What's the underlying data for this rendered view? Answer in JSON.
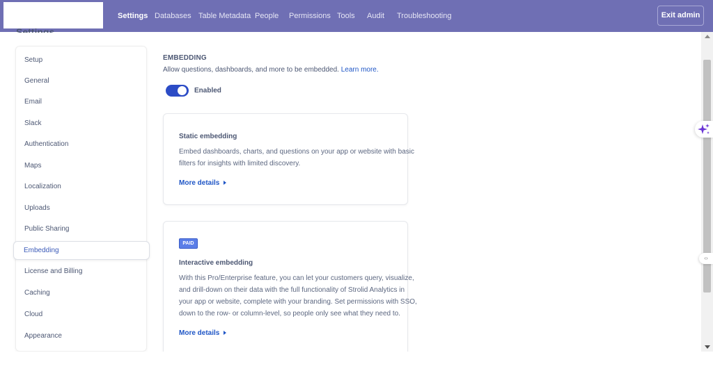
{
  "nav": {
    "items": [
      {
        "label": "Settings",
        "active": true
      },
      {
        "label": "Databases"
      },
      {
        "label": "Table Metadata"
      },
      {
        "label": "People"
      },
      {
        "label": "Permissions"
      },
      {
        "label": "Tools"
      },
      {
        "label": "Audit"
      },
      {
        "label": "Troubleshooting"
      }
    ],
    "exit_label": "Exit admin"
  },
  "settings_heading": "Settings",
  "sidebar": {
    "items": [
      {
        "label": "Setup"
      },
      {
        "label": "General"
      },
      {
        "label": "Email"
      },
      {
        "label": "Slack"
      },
      {
        "label": "Authentication"
      },
      {
        "label": "Maps"
      },
      {
        "label": "Localization"
      },
      {
        "label": "Uploads"
      },
      {
        "label": "Public Sharing"
      },
      {
        "label": "Embedding",
        "active": true
      },
      {
        "label": "License and Billing"
      },
      {
        "label": "Caching"
      },
      {
        "label": "Cloud"
      },
      {
        "label": "Appearance"
      }
    ]
  },
  "main": {
    "section_title": "EMBEDDING",
    "section_desc": "Allow questions, dashboards, and more to be embedded.",
    "learn_more": "Learn more.",
    "toggle": {
      "label": "Enabled",
      "on": true
    },
    "static_card": {
      "title": "Static embedding",
      "lines": [
        "Embed dashboards, charts, and questions on your app or website with basic",
        "filters for insights with limited discovery."
      ],
      "more_details": "More details"
    },
    "interactive_card": {
      "badge": "PAID",
      "title": "Interactive embedding",
      "lines": [
        "With this Pro/Enterprise feature, you can let your customers query, visualize,",
        "and drill-down on their data with the full functionality of Strolid Analytics in",
        "your app or website, complete with your branding. Set permissions with SSO,",
        "down to the row- or column-level, so people only see what they need to."
      ],
      "more_details": "More details"
    }
  },
  "colors": {
    "topbar": "#6f6fb4",
    "accent": "#2c4cc6",
    "link": "#1f56c6",
    "badge": "#5b7ee8"
  }
}
